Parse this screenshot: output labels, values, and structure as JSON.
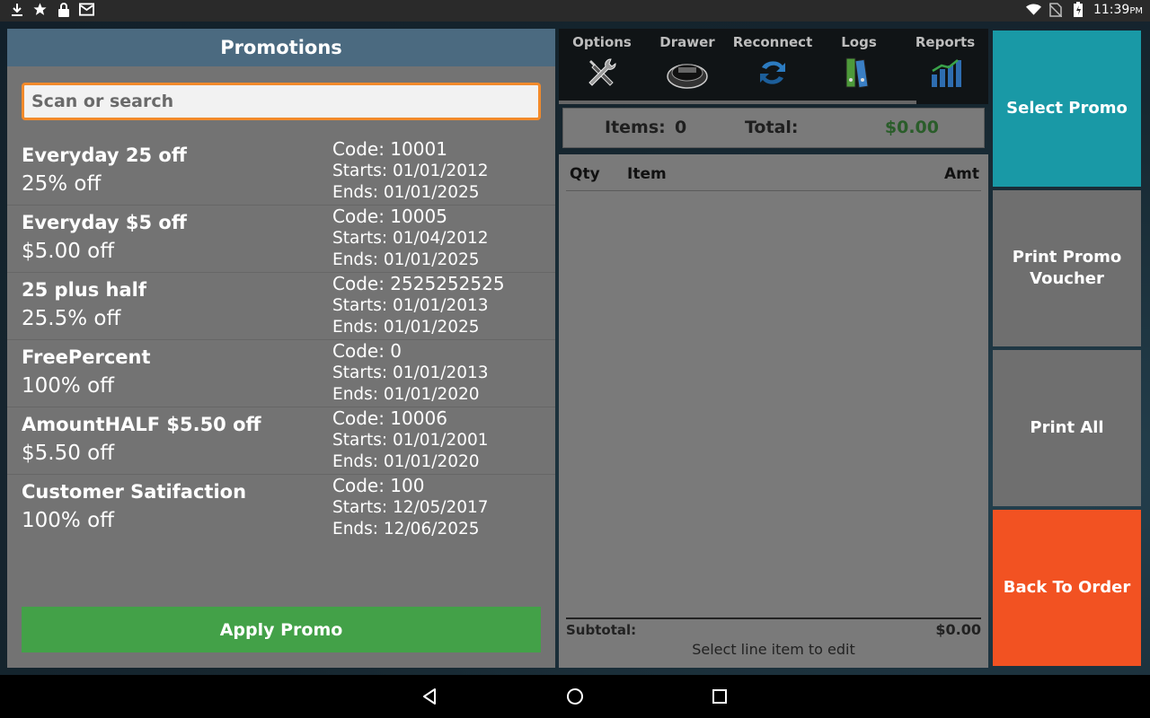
{
  "status_bar": {
    "icons_left": [
      "download-icon",
      "star-icon",
      "lock-icon",
      "mail-icon"
    ],
    "icons_right": [
      "wifi-icon",
      "no-sim-icon",
      "battery-icon"
    ],
    "time": "11:39",
    "ampm": "PM"
  },
  "promotions": {
    "title": "Promotions",
    "search_placeholder": "Scan or search",
    "items": [
      {
        "name": "Everyday 25 off",
        "discount": "25% off",
        "code": "Code: 10001",
        "starts": "Starts: 01/01/2012",
        "ends": "Ends: 01/01/2025"
      },
      {
        "name": "Everyday $5 off",
        "discount": "$5.00 off",
        "code": "Code: 10005",
        "starts": "Starts: 01/04/2012",
        "ends": "Ends: 01/01/2025"
      },
      {
        "name": "25 plus half",
        "discount": "25.5% off",
        "code": "Code: 2525252525",
        "starts": "Starts: 01/01/2013",
        "ends": "Ends: 01/01/2025"
      },
      {
        "name": "FreePercent",
        "discount": "100% off",
        "code": "Code: 0",
        "starts": "Starts: 01/01/2013",
        "ends": "Ends: 01/01/2020"
      },
      {
        "name": "AmountHALF $5.50 off",
        "discount": "$5.50 off",
        "code": "Code: 10006",
        "starts": "Starts: 01/01/2001",
        "ends": "Ends: 01/01/2020"
      },
      {
        "name": "Customer Satifaction",
        "discount": "100% off",
        "code": "Code: 100",
        "starts": "Starts: 12/05/2017",
        "ends": "Ends: 12/06/2025"
      }
    ],
    "apply_label": "Apply Promo"
  },
  "toolbar": {
    "items": [
      {
        "label": "Options",
        "icon": "tools-icon"
      },
      {
        "label": "Drawer",
        "icon": "cash-drawer-icon"
      },
      {
        "label": "Reconnect",
        "icon": "reconnect-icon"
      },
      {
        "label": "Logs",
        "icon": "logs-icon"
      },
      {
        "label": "Reports",
        "icon": "reports-icon"
      }
    ]
  },
  "summary": {
    "items_label": "Items:",
    "items_value": "0",
    "total_label": "Total:",
    "total_value": "$0.00"
  },
  "order": {
    "col_qty": "Qty",
    "col_item": "Item",
    "col_amt": "Amt",
    "subtotal_label": "Subtotal:",
    "subtotal_value": "$0.00",
    "hint": "Select line item to edit"
  },
  "actions": {
    "select_promo": "Select Promo",
    "print_voucher": "Print Promo Voucher",
    "print_all": "Print All",
    "back_to_order": "Back To Order"
  },
  "colors": {
    "header": "#4b6a80",
    "search_border": "#f28a2b",
    "apply": "#43a148",
    "select_promo": "#1999a6",
    "back_to_order": "#f25222",
    "total_value": "#2a5d2a"
  },
  "nav": {
    "icons": [
      "back-icon",
      "home-icon",
      "recents-icon"
    ]
  }
}
